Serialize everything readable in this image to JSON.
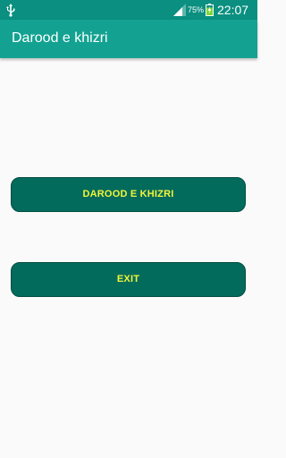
{
  "status_bar": {
    "battery_percent": "75%",
    "time": "22:07",
    "icons": [
      "usb-icon",
      "signal-icon",
      "battery-charging-icon"
    ]
  },
  "app_bar": {
    "title": "Darood e khizri"
  },
  "buttons": {
    "darood_label": "DAROOD E KHIZRI",
    "exit_label": "EXIT"
  },
  "colors": {
    "status_bar": "#0a8f80",
    "app_bar": "#13a291",
    "button_bg": "#036b5b",
    "button_text": "#f2f53a",
    "background": "#fafafa"
  }
}
